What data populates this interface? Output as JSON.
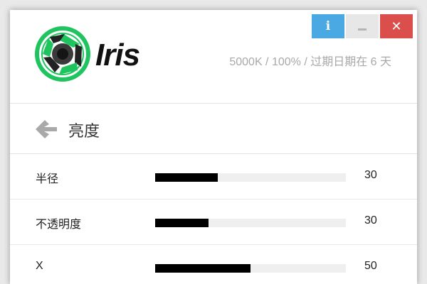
{
  "window_buttons": {
    "info": "i",
    "close": "✕"
  },
  "header": {
    "brand": "Iris",
    "status": "5000K / 100% / 过期日期在 6 天",
    "logo_icon": "iris-aperture-icon",
    "colors": {
      "logo_green": "#1fc45f",
      "logo_dark": "#222222"
    }
  },
  "subheader": {
    "title": "亮度",
    "back_icon": "back-arrow-icon"
  },
  "sliders": [
    {
      "label": "半径",
      "value": "30",
      "fill": 0.33
    },
    {
      "label": "不透明度",
      "value": "30",
      "fill": 0.28
    },
    {
      "label": "X",
      "value": "50",
      "fill": 0.5
    }
  ],
  "colors": {
    "info": "#4aa8e3",
    "minimize": "#e7e7e7",
    "close": "#da4f4b",
    "slider_fill": "#000000",
    "slider_track": "#efefef"
  }
}
